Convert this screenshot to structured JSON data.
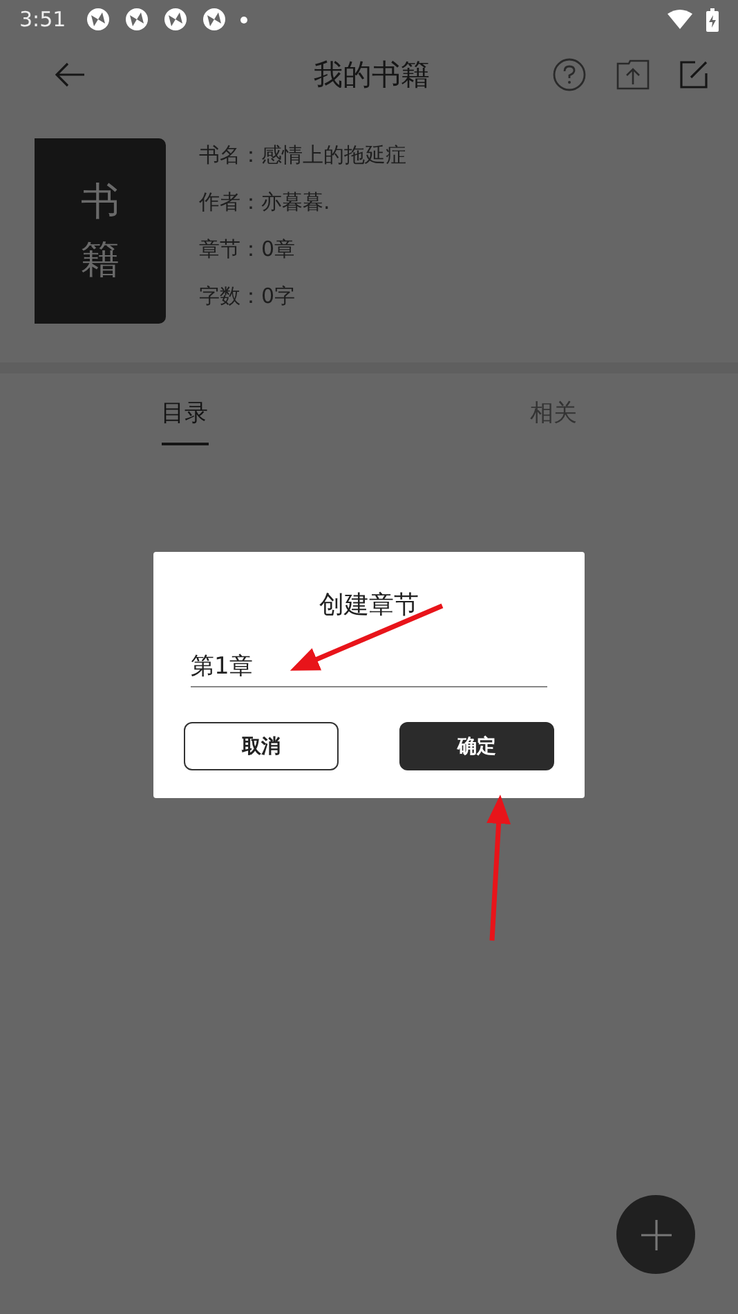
{
  "status_bar": {
    "time": "3:51"
  },
  "app_bar": {
    "title": "我的书籍"
  },
  "book": {
    "cover_text": "书籍",
    "fields": [
      "书名：感情上的拖延症",
      "作者：亦暮暮.",
      "章节：0章",
      "字数：0字"
    ]
  },
  "tabs": [
    {
      "label": "目录",
      "selected": true
    },
    {
      "label": "相关",
      "selected": false
    }
  ],
  "dialog": {
    "title": "创建章节",
    "input": {
      "value": "第1章"
    },
    "buttons": [
      {
        "label": "取消",
        "kind": "outline"
      },
      {
        "label": "确定",
        "kind": "filled"
      }
    ]
  }
}
